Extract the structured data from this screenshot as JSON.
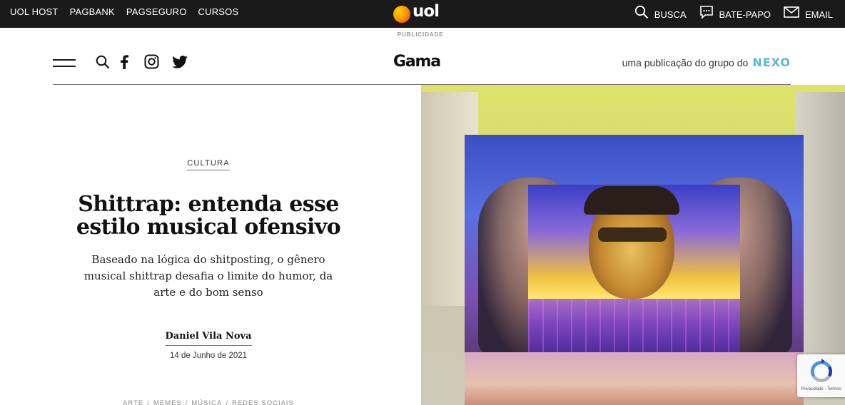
{
  "uol_bar": {
    "links": [
      "UOL HOST",
      "PAGBANK",
      "PAGSEGURO",
      "CURSOS"
    ],
    "logo_text": "uol",
    "right": [
      {
        "icon": "search-icon",
        "label": "BUSCA"
      },
      {
        "icon": "chat-icon",
        "label": "BATE-PAPO"
      },
      {
        "icon": "mail-icon",
        "label": "EMAIL"
      }
    ]
  },
  "ad": {
    "label": "PUBLICIDADE"
  },
  "header": {
    "logo": "Gama",
    "publisher_text": "uma publicação do grupo do",
    "publisher_brand": "NEXO"
  },
  "article": {
    "category": "CULTURA",
    "title": "Shittrap: entenda esse estilo musical ofensivo",
    "subtitle": "Baseado na lógica do shitposting, o gênero musical shittrap desafia o limite do humor, da arte e do bom senso",
    "author": "Daniel Vila Nova",
    "date": "14 de Junho de 2021",
    "tags": [
      "ARTE",
      "MEMES",
      "MÚSICA",
      "REDES SOCIAIS"
    ]
  },
  "recaptcha": {
    "text": "Privacidade - Termos"
  },
  "colors": {
    "uol_bar": "#1a1a1a",
    "nexo_accent": "#5ab7d8"
  }
}
